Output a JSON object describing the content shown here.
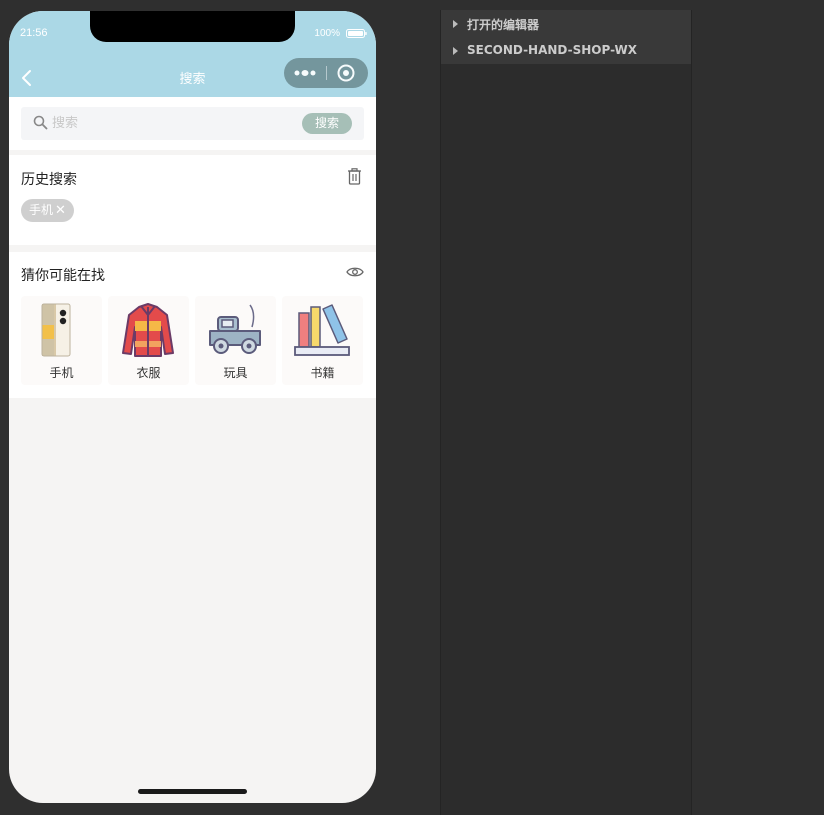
{
  "status_bar": {
    "time": "21:56",
    "battery": "100%"
  },
  "nav": {
    "title": "搜索"
  },
  "search": {
    "placeholder": "搜索",
    "value": "",
    "button_label": "搜索"
  },
  "history": {
    "title": "历史搜索",
    "tags": [
      {
        "label": "手机",
        "close": "✕"
      }
    ]
  },
  "guess": {
    "title": "猜你可能在找",
    "categories": [
      {
        "label": "手机",
        "icon": "phone-icon"
      },
      {
        "label": "衣服",
        "icon": "jacket-icon"
      },
      {
        "label": "玩具",
        "icon": "toy-truck-icon"
      },
      {
        "label": "书籍",
        "icon": "books-icon"
      }
    ]
  },
  "explorer": {
    "items": [
      {
        "label": "打开的编辑器"
      },
      {
        "label": "SECOND-HAND-SHOP-WX"
      }
    ]
  },
  "colors": {
    "header": "#abd8e6",
    "search_button": "#a6bfb7",
    "tag": "#cfcfcf",
    "ide_background": "#2f2f2f"
  }
}
